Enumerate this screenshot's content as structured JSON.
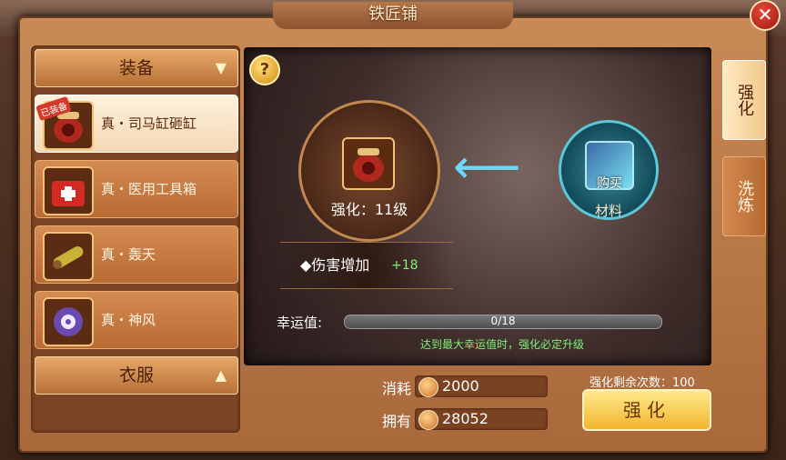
{
  "window": {
    "title": "铁匠铺",
    "close_icon": "close-icon"
  },
  "left_panel": {
    "category_equipment": "装备",
    "category_clothing": "衣服",
    "items": [
      {
        "name": "真・司马缸砸缸",
        "badge": "已装备",
        "icon": "bag-icon",
        "selected": true
      },
      {
        "name": "真・医用工具箱",
        "icon": "medkit-icon",
        "selected": false
      },
      {
        "name": "真・轰天",
        "icon": "cannon-icon",
        "selected": false
      },
      {
        "name": "真・神风",
        "icon": "shuriken-icon",
        "selected": false
      }
    ]
  },
  "main": {
    "help_label": "?",
    "target_level": "强化：11级",
    "material_buy": "购买",
    "material_label": "材料",
    "stat_name": "◆伤害增加",
    "stat_value": "+18",
    "luck_label": "幸运值:",
    "luck_value": "0/18",
    "luck_progress": 0,
    "hint": "达到最大幸运值时，强化必定升级"
  },
  "tabs": [
    {
      "label": "强化",
      "active": true
    },
    {
      "label": "洗炼",
      "active": false
    }
  ],
  "bottom": {
    "cost_label": "消耗",
    "cost_value": "2000",
    "owned_label": "拥有",
    "owned_value": "28052",
    "remaining_text": "强化剩余次数：100",
    "action_button": "强化"
  },
  "colors": {
    "accent": "#f2b52e",
    "bonus": "#7ef07a",
    "close": "#c0271c"
  }
}
